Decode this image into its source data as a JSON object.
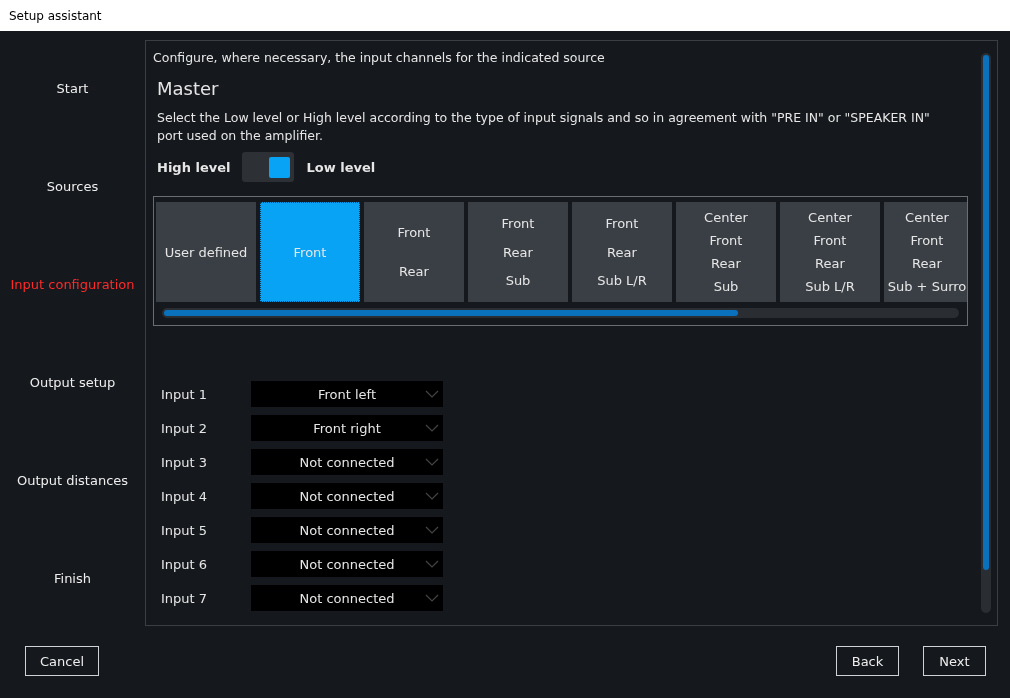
{
  "window": {
    "title": "Setup assistant"
  },
  "steps": [
    {
      "label": "Start",
      "selected": false
    },
    {
      "label": "Sources",
      "selected": false
    },
    {
      "label": "Input configuration",
      "selected": true
    },
    {
      "label": "Output setup",
      "selected": false
    },
    {
      "label": "Output distances",
      "selected": false
    },
    {
      "label": "Finish",
      "selected": false
    }
  ],
  "instruction": "Configure, where necessary, the input channels for the indicated source",
  "source_title": "Master",
  "description": "Select the Low level or High level according to the type of input signals and so in agreement with \"PRE IN\" or \"SPEAKER IN\" port used on the amplifier.",
  "level_switch": {
    "left_label": "High level",
    "right_label": "Low level",
    "low_level": true
  },
  "presets": [
    {
      "lines": [
        "User defined"
      ],
      "selected": false
    },
    {
      "lines": [
        "Front"
      ],
      "selected": true
    },
    {
      "lines": [
        "Front",
        "Rear"
      ],
      "selected": false
    },
    {
      "lines": [
        "Front",
        "Rear",
        "Sub"
      ],
      "selected": false
    },
    {
      "lines": [
        "Front",
        "Rear",
        "Sub L/R"
      ],
      "selected": false
    },
    {
      "lines": [
        "Center",
        "Front",
        "Rear",
        "Sub"
      ],
      "selected": false
    },
    {
      "lines": [
        "Center",
        "Front",
        "Rear",
        "Sub L/R"
      ],
      "selected": false
    },
    {
      "lines": [
        "Center",
        "Front",
        "Rear",
        "Sub + Surro"
      ],
      "selected": false
    }
  ],
  "inputs": [
    {
      "label": "Input 1",
      "value": "Front left"
    },
    {
      "label": "Input 2",
      "value": "Front right"
    },
    {
      "label": "Input 3",
      "value": "Not connected"
    },
    {
      "label": "Input 4",
      "value": "Not connected"
    },
    {
      "label": "Input 5",
      "value": "Not connected"
    },
    {
      "label": "Input 6",
      "value": "Not connected"
    },
    {
      "label": "Input 7",
      "value": "Not connected"
    }
  ],
  "buttons": {
    "cancel": "Cancel",
    "back": "Back",
    "next": "Next"
  }
}
